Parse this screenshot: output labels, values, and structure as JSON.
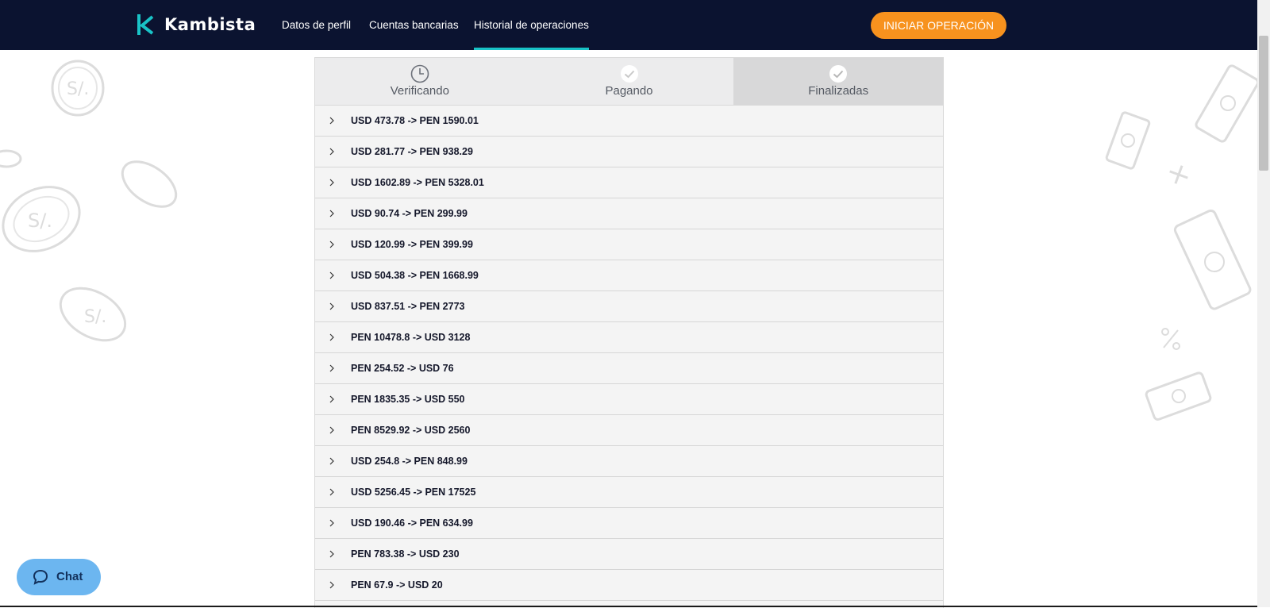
{
  "header": {
    "brand": "Kambista",
    "nav": [
      {
        "label": "Datos de perfil",
        "active": false
      },
      {
        "label": "Cuentas bancarias",
        "active": false
      },
      {
        "label": "Historial de operaciones",
        "active": true
      }
    ],
    "cta_label": "INICIAR OPERACIÓN"
  },
  "tabs": [
    {
      "label": "Verificando",
      "icon": "clock-icon",
      "active": false
    },
    {
      "label": "Pagando",
      "icon": "check-circle-icon",
      "active": false
    },
    {
      "label": "Finalizadas",
      "icon": "check-circle-icon",
      "active": true
    }
  ],
  "operations": [
    "USD 473.78 -> PEN 1590.01",
    "USD 281.77 -> PEN 938.29",
    "USD 1602.89 -> PEN 5328.01",
    "USD 90.74 -> PEN 299.99",
    "USD 120.99 -> PEN 399.99",
    "USD 504.38 -> PEN 1668.99",
    "USD 837.51 -> PEN 2773",
    "PEN 10478.8 -> USD 3128",
    "PEN 254.52 -> USD 76",
    "PEN 1835.35 -> USD 550",
    "PEN 8529.92 -> USD 2560",
    "USD 254.8 -> PEN 848.99",
    "USD 5256.45 -> PEN 17525",
    "USD 190.46 -> PEN 634.99",
    "PEN 783.38 -> USD 230",
    "PEN 67.9 -> USD 20"
  ],
  "chat": {
    "label": "Chat"
  },
  "colors": {
    "navbar": "#0b1330",
    "accent": "#19c3c7",
    "cta": "#f7921e",
    "chat": "#6cb6f0"
  }
}
